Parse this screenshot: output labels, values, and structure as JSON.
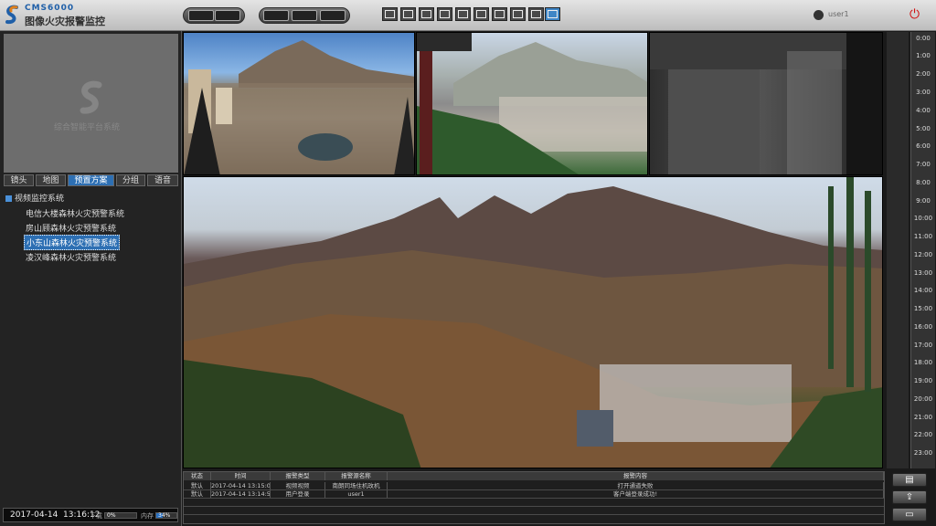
{
  "app": {
    "brand_en": "CMS6000",
    "brand_cn": "图像火灾报警监控"
  },
  "toolbar": {
    "user": "user1"
  },
  "left": {
    "preview_text": "综合智能平台系统",
    "tabs": [
      "镜头",
      "地图",
      "预置方案",
      "分组",
      "语音"
    ],
    "active_tab": 2,
    "tree_root": "视频监控系统",
    "tree_items": [
      "电信大楼森林火灾预警系统",
      "房山顾森林火灾预警系统",
      "小东山森林火灾预警系统",
      "凌汉峰森林火灾预警系统"
    ],
    "selected_item": 2,
    "status": {
      "date": "2017-04-14",
      "time": "13:16:12",
      "download_label": "下载",
      "download_value": "0%",
      "download_fraction": 0.0,
      "memory_label": "内存",
      "memory_value": "34%",
      "memory_fraction": 0.34
    }
  },
  "time_axis": [
    "0:00",
    "1:00",
    "2:00",
    "3:00",
    "4:00",
    "5:00",
    "6:00",
    "7:00",
    "8:00",
    "9:00",
    "10:00",
    "11:00",
    "12:00",
    "13:00",
    "14:00",
    "15:00",
    "16:00",
    "17:00",
    "18:00",
    "19:00",
    "20:00",
    "21:00",
    "22:00",
    "23:00"
  ],
  "alarm": {
    "headers": [
      "状态",
      "时间",
      "报警类型",
      "报警源名称",
      "报警内容"
    ],
    "rows": [
      [
        "默认",
        "2017-04-14 13:15:04",
        "视频视频",
        "南朗同场住机玫机",
        "打开通道失败"
      ],
      [
        "默认",
        "2017-04-14 13:14:55",
        "用户登录",
        "user1",
        "客户端登录成功!"
      ]
    ]
  },
  "colors": {
    "accent": "#2d6fb3",
    "power": "#d01010"
  }
}
